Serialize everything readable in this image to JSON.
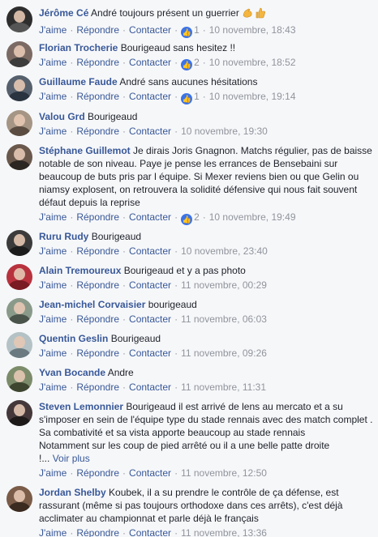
{
  "actions": {
    "like": "J'aime",
    "reply": "Répondre",
    "contact": "Contacter",
    "see_more": "Voir plus",
    "dot": "·",
    "ellipsis": "!..."
  },
  "comments": [
    {
      "name": "Jérôme Cé",
      "text": "André toujours présent un guerrier",
      "likes": "1",
      "time": "10 novembre, 18:43",
      "avatar_color": "#3a3a3a",
      "liked_color": "#4267b2"
    },
    {
      "name": "Florian Trocherie",
      "text": "Bourigeaud sans hesitez !!",
      "likes": "2",
      "time": "10 novembre, 18:52",
      "avatar_color": "#6b5b55"
    },
    {
      "name": "Guillaume Faude",
      "text": "André sans aucunes hésitations",
      "likes": "1",
      "time": "10 novembre, 19:14",
      "avatar_color": "#4a5a6a"
    },
    {
      "name": "Valou Grd",
      "text": "Bourigeaud",
      "likes": "",
      "time": "10 novembre, 19:30",
      "avatar_color": "#8a7a6a"
    },
    {
      "name": "Stéphane Guillemot",
      "text_lines": [
        "Je dirais Joris Gnagnon. Matchs régulier, pas de baisse",
        "notable de son niveau. Paye je pense les errances de Bensebaini sur",
        "beaucoup de buts pris par l équipe. Si Mexer reviens bien ou que Gelin ou",
        "niamsy explosent, on retrouvera la solidité défensive qui nous fait souvent",
        "défaut depuis la reprise"
      ],
      "likes": "2",
      "time": "10 novembre, 19:49",
      "avatar_color": "#5a4a40"
    },
    {
      "name": "Ruru Rudy",
      "text": "Bourigeaud",
      "likes": "",
      "time": "10 novembre, 23:40",
      "avatar_color": "#3a3a3a"
    },
    {
      "name": "Alain Tremoureux",
      "text": "Bourigeaud et y a pas photo",
      "likes": "",
      "time": "11 novembre, 00:29",
      "avatar_color": "#b0303a"
    },
    {
      "name": "Jean-michel Corvaisier",
      "text": "bourigeaud",
      "likes": "",
      "time": "11 novembre, 06:03",
      "avatar_color": "#7a8a7a"
    },
    {
      "name": "Quentin Geslin",
      "text": "Bourigeaud",
      "likes": "",
      "time": "11 novembre, 09:26",
      "avatar_color": "#9aaab0"
    },
    {
      "name": "Yvan Bocande",
      "text": "Andre",
      "likes": "",
      "time": "11 novembre, 11:31",
      "avatar_color": "#6a7a5a"
    },
    {
      "name": "Steven Lemonnier",
      "text_lines": [
        "Bourigeaud il est arrivé de lens au mercato et a su",
        "s'imposer en sein de l'équipe type du stade rennais avec des match complet .",
        "Sa combativité et sa vista apporte beaucoup au stade rennais",
        "Notamment sur les coup de pied arrêté ou il a une belle patte droite"
      ],
      "likes": "",
      "time": "11 novembre, 12:50",
      "avatar_color": "#3a3030"
    },
    {
      "name": "Jordan Shelby",
      "text_lines": [
        "Koubek, il a su prendre le contrôle de ça défense, est",
        "rassurant (même si pas toujours orthodoxe dans ces arrêts), c'est déjà",
        "acclimater au championnat et parle déjà le français"
      ],
      "likes": "",
      "time": "11 novembre, 13:36",
      "avatar_color": "#6a5040"
    }
  ]
}
